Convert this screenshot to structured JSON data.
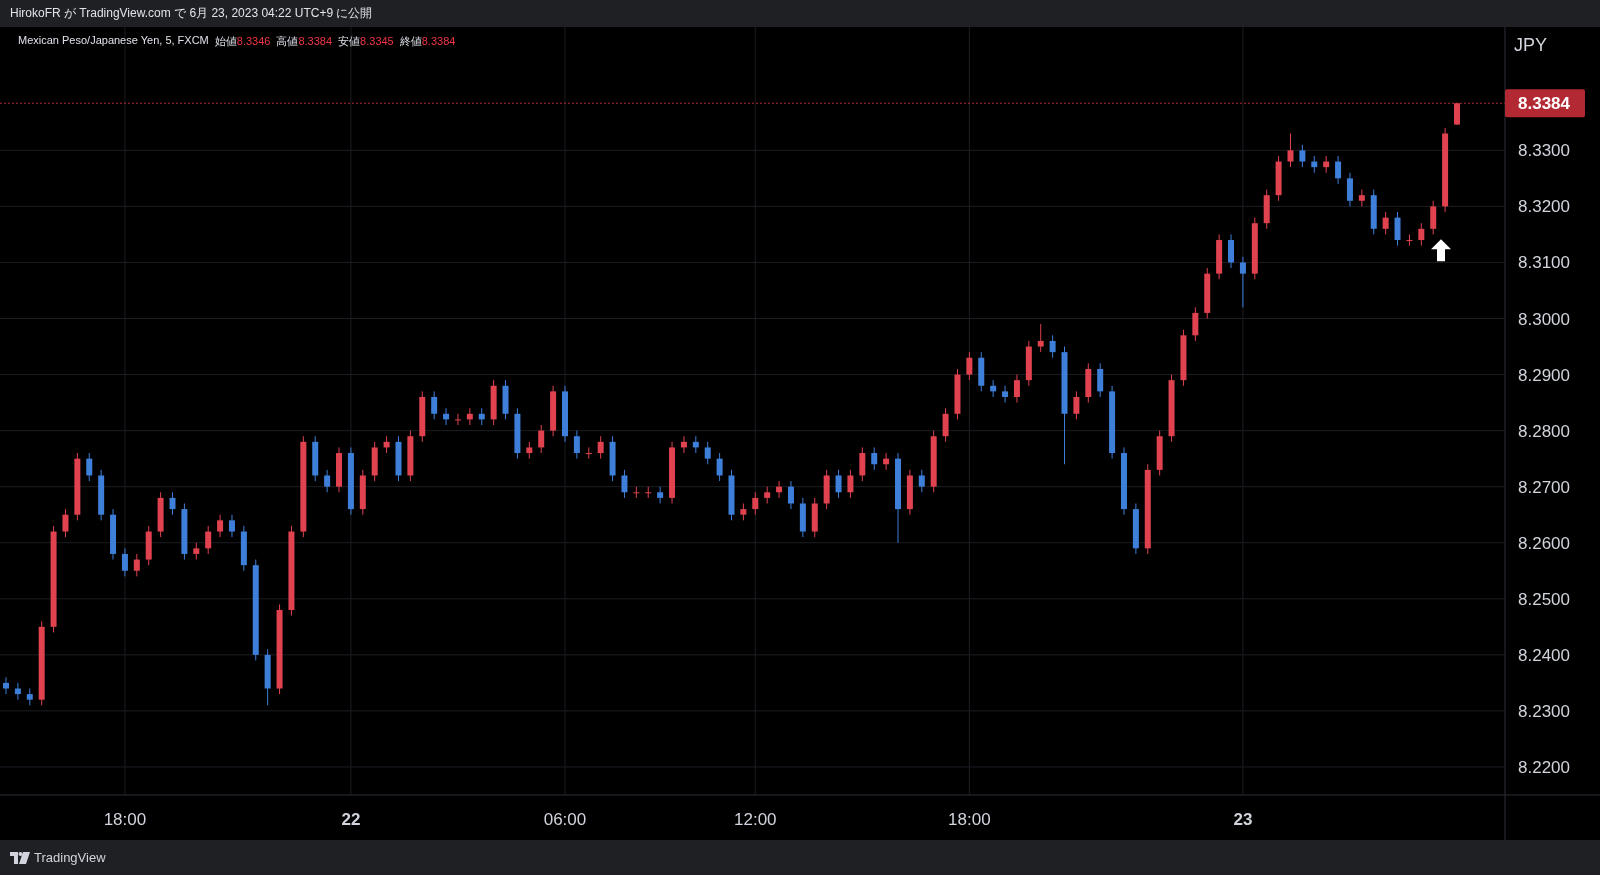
{
  "header": {
    "text": "HirokoFR が TradingView.com で 6月 23, 2023 04:22 UTC+9 に公開"
  },
  "legend": {
    "symbol": "Mexican Peso/Japanese Yen, 5, FXCM",
    "fields": [
      {
        "label": "始値",
        "value": "8.3346"
      },
      {
        "label": "高値",
        "value": "8.3384"
      },
      {
        "label": "安値",
        "value": "8.3345"
      },
      {
        "label": "終値",
        "value": "8.3384"
      }
    ]
  },
  "price_axis": {
    "currency": "JPY"
  },
  "chart_data": {
    "type": "candlestick",
    "categories": [
      null,
      null,
      null,
      null,
      null,
      null,
      null,
      null,
      null,
      null,
      "18:00",
      null,
      null,
      null,
      null,
      null,
      null,
      null,
      null,
      null,
      null,
      null,
      null,
      null,
      null,
      null,
      null,
      null,
      null,
      "22",
      null,
      null,
      null,
      null,
      null,
      null,
      null,
      null,
      null,
      null,
      null,
      null,
      null,
      null,
      null,
      null,
      null,
      "06:00",
      null,
      null,
      null,
      null,
      null,
      null,
      null,
      null,
      null,
      null,
      null,
      null,
      null,
      null,
      null,
      "12:00",
      null,
      null,
      null,
      null,
      null,
      null,
      null,
      null,
      null,
      null,
      null,
      null,
      null,
      null,
      null,
      null,
      null,
      "18:00",
      null,
      null,
      null,
      null,
      null,
      null,
      null,
      null,
      null,
      null,
      null,
      null,
      null,
      null,
      null,
      null,
      null,
      null,
      null,
      null,
      null,
      null,
      "23",
      null,
      null,
      null,
      null,
      null,
      null,
      null,
      null,
      null,
      null,
      null,
      null,
      null,
      null,
      null,
      null,
      null,
      null
    ],
    "ohlc": [
      [
        8.235,
        8.236,
        8.233,
        8.234
      ],
      [
        8.234,
        8.235,
        8.232,
        8.233
      ],
      [
        8.233,
        8.234,
        8.231,
        8.232
      ],
      [
        8.232,
        8.246,
        8.231,
        8.245
      ],
      [
        8.245,
        8.263,
        8.244,
        8.262
      ],
      [
        8.262,
        8.266,
        8.261,
        8.265
      ],
      [
        8.265,
        8.276,
        8.264,
        8.275
      ],
      [
        8.275,
        8.276,
        8.271,
        8.272
      ],
      [
        8.272,
        8.273,
        8.264,
        8.265
      ],
      [
        8.265,
        8.266,
        8.257,
        8.258
      ],
      [
        8.258,
        8.259,
        8.254,
        8.255
      ],
      [
        8.255,
        8.258,
        8.254,
        8.257
      ],
      [
        8.257,
        8.263,
        8.256,
        8.262
      ],
      [
        8.262,
        8.269,
        8.261,
        8.268
      ],
      [
        8.268,
        8.269,
        8.265,
        8.266
      ],
      [
        8.266,
        8.267,
        8.257,
        8.258
      ],
      [
        8.258,
        8.26,
        8.257,
        8.259
      ],
      [
        8.259,
        8.263,
        8.258,
        8.262
      ],
      [
        8.262,
        8.265,
        8.261,
        8.264
      ],
      [
        8.264,
        8.265,
        8.261,
        8.262
      ],
      [
        8.262,
        8.263,
        8.255,
        8.256
      ],
      [
        8.256,
        8.257,
        8.239,
        8.24
      ],
      [
        8.24,
        8.241,
        8.231,
        8.234
      ],
      [
        8.234,
        8.249,
        8.233,
        8.248
      ],
      [
        8.248,
        8.263,
        8.247,
        8.262
      ],
      [
        8.262,
        8.279,
        8.261,
        8.278
      ],
      [
        8.278,
        8.279,
        8.271,
        8.272
      ],
      [
        8.272,
        8.273,
        8.269,
        8.27
      ],
      [
        8.27,
        8.277,
        8.269,
        8.276
      ],
      [
        8.276,
        8.277,
        8.265,
        8.266
      ],
      [
        8.266,
        8.273,
        8.265,
        8.272
      ],
      [
        8.272,
        8.278,
        8.271,
        8.277
      ],
      [
        8.277,
        8.279,
        8.276,
        8.278
      ],
      [
        8.278,
        8.279,
        8.271,
        8.272
      ],
      [
        8.272,
        8.28,
        8.271,
        8.279
      ],
      [
        8.279,
        8.287,
        8.278,
        8.286
      ],
      [
        8.286,
        8.287,
        8.282,
        8.283
      ],
      [
        8.283,
        8.284,
        8.281,
        8.282
      ],
      [
        8.282,
        8.283,
        8.281,
        8.282
      ],
      [
        8.282,
        8.284,
        8.281,
        8.283
      ],
      [
        8.283,
        8.284,
        8.281,
        8.282
      ],
      [
        8.282,
        8.289,
        8.281,
        8.288
      ],
      [
        8.288,
        8.289,
        8.282,
        8.283
      ],
      [
        8.283,
        8.284,
        8.275,
        8.276
      ],
      [
        8.276,
        8.278,
        8.275,
        8.277
      ],
      [
        8.277,
        8.281,
        8.276,
        8.28
      ],
      [
        8.28,
        8.288,
        8.279,
        8.287
      ],
      [
        8.287,
        8.288,
        8.278,
        8.279
      ],
      [
        8.279,
        8.28,
        8.275,
        8.276
      ],
      [
        8.276,
        8.277,
        8.275,
        8.276
      ],
      [
        8.276,
        8.279,
        8.275,
        8.278
      ],
      [
        8.278,
        8.279,
        8.271,
        8.272
      ],
      [
        8.272,
        8.273,
        8.268,
        8.269
      ],
      [
        8.269,
        8.27,
        8.268,
        8.269
      ],
      [
        8.269,
        8.27,
        8.268,
        8.269
      ],
      [
        8.269,
        8.27,
        8.267,
        8.268
      ],
      [
        8.268,
        8.278,
        8.267,
        8.277
      ],
      [
        8.277,
        8.279,
        8.276,
        8.278
      ],
      [
        8.278,
        8.279,
        8.276,
        8.277
      ],
      [
        8.277,
        8.278,
        8.274,
        8.275
      ],
      [
        8.275,
        8.276,
        8.271,
        8.272
      ],
      [
        8.272,
        8.273,
        8.264,
        8.265
      ],
      [
        8.265,
        8.267,
        8.264,
        8.266
      ],
      [
        8.266,
        8.269,
        8.265,
        8.268
      ],
      [
        8.268,
        8.27,
        8.267,
        8.269
      ],
      [
        8.269,
        8.271,
        8.268,
        8.27
      ],
      [
        8.27,
        8.271,
        8.266,
        8.267
      ],
      [
        8.267,
        8.268,
        8.261,
        8.262
      ],
      [
        8.262,
        8.268,
        8.261,
        8.267
      ],
      [
        8.267,
        8.273,
        8.266,
        8.272
      ],
      [
        8.272,
        8.273,
        8.268,
        8.269
      ],
      [
        8.269,
        8.273,
        8.268,
        8.272
      ],
      [
        8.272,
        8.277,
        8.271,
        8.276
      ],
      [
        8.276,
        8.277,
        8.273,
        8.274
      ],
      [
        8.274,
        8.276,
        8.273,
        8.275
      ],
      [
        8.275,
        8.276,
        8.26,
        8.266
      ],
      [
        8.266,
        8.273,
        8.265,
        8.272
      ],
      [
        8.272,
        8.273,
        8.269,
        8.27
      ],
      [
        8.27,
        8.28,
        8.269,
        8.279
      ],
      [
        8.279,
        8.284,
        8.278,
        8.283
      ],
      [
        8.283,
        8.291,
        8.282,
        8.29
      ],
      [
        8.29,
        8.294,
        8.289,
        8.293
      ],
      [
        8.293,
        8.294,
        8.287,
        8.288
      ],
      [
        8.288,
        8.289,
        8.286,
        8.287
      ],
      [
        8.287,
        8.288,
        8.285,
        8.286
      ],
      [
        8.286,
        8.29,
        8.285,
        8.289
      ],
      [
        8.289,
        8.296,
        8.288,
        8.295
      ],
      [
        8.295,
        8.299,
        8.294,
        8.296
      ],
      [
        8.296,
        8.297,
        8.293,
        8.294
      ],
      [
        8.294,
        8.295,
        8.274,
        8.283
      ],
      [
        8.283,
        8.287,
        8.282,
        8.286
      ],
      [
        8.286,
        8.292,
        8.285,
        8.291
      ],
      [
        8.291,
        8.292,
        8.286,
        8.287
      ],
      [
        8.287,
        8.288,
        8.275,
        8.276
      ],
      [
        8.276,
        8.277,
        8.265,
        8.266
      ],
      [
        8.266,
        8.267,
        8.258,
        8.259
      ],
      [
        8.259,
        8.274,
        8.258,
        8.273
      ],
      [
        8.273,
        8.28,
        8.272,
        8.279
      ],
      [
        8.279,
        8.29,
        8.278,
        8.289
      ],
      [
        8.289,
        8.298,
        8.288,
        8.297
      ],
      [
        8.297,
        8.302,
        8.296,
        8.301
      ],
      [
        8.301,
        8.309,
        8.3,
        8.308
      ],
      [
        8.308,
        8.315,
        8.307,
        8.314
      ],
      [
        8.314,
        8.315,
        8.309,
        8.31
      ],
      [
        8.31,
        8.311,
        8.302,
        8.308
      ],
      [
        8.308,
        8.318,
        8.307,
        8.317
      ],
      [
        8.317,
        8.323,
        8.316,
        8.322
      ],
      [
        8.322,
        8.329,
        8.321,
        8.328
      ],
      [
        8.328,
        8.333,
        8.327,
        8.33
      ],
      [
        8.33,
        8.331,
        8.327,
        8.328
      ],
      [
        8.328,
        8.329,
        8.326,
        8.327
      ],
      [
        8.327,
        8.329,
        8.326,
        8.328
      ],
      [
        8.328,
        8.329,
        8.324,
        8.325
      ],
      [
        8.325,
        8.326,
        8.32,
        8.321
      ],
      [
        8.321,
        8.323,
        8.32,
        8.322
      ],
      [
        8.322,
        8.323,
        8.315,
        8.316
      ],
      [
        8.316,
        8.319,
        8.315,
        8.318
      ],
      [
        8.318,
        8.319,
        8.313,
        8.314
      ],
      [
        8.314,
        8.315,
        8.313,
        8.314
      ],
      [
        8.314,
        8.317,
        8.313,
        8.316
      ],
      [
        8.316,
        8.321,
        8.315,
        8.32
      ],
      [
        8.32,
        8.334,
        8.319,
        8.333
      ],
      [
        8.3346,
        8.3384,
        8.3345,
        8.3384
      ]
    ],
    "ylim": [
      8.215,
      8.352
    ],
    "grid": true,
    "ref_lines": [
      {
        "axis": "y",
        "value": 8.3384,
        "label": "8.3384",
        "color": "#b22833"
      }
    ],
    "yticks": [
      {
        "value": 8.22,
        "label": "8.2200"
      },
      {
        "value": 8.23,
        "label": "8.2300"
      },
      {
        "value": 8.24,
        "label": "8.2400"
      },
      {
        "value": 8.25,
        "label": "8.2500"
      },
      {
        "value": 8.26,
        "label": "8.2600"
      },
      {
        "value": 8.27,
        "label": "8.2700"
      },
      {
        "value": 8.28,
        "label": "8.2800"
      },
      {
        "value": 8.29,
        "label": "8.2900"
      },
      {
        "value": 8.3,
        "label": "8.3000"
      },
      {
        "value": 8.31,
        "label": "8.3100"
      },
      {
        "value": 8.32,
        "label": "8.3200"
      },
      {
        "value": 8.33,
        "label": "8.3300"
      }
    ]
  },
  "footer": {
    "brand": "TradingView"
  }
}
